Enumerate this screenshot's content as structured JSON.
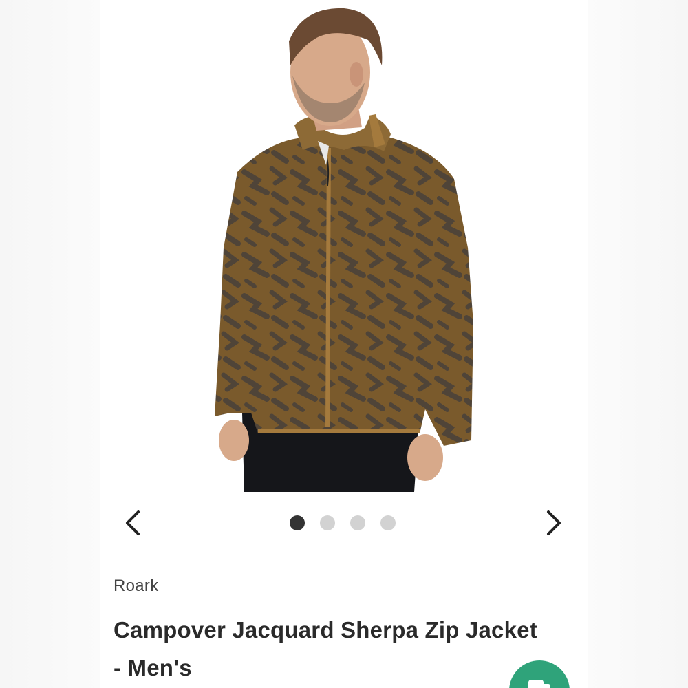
{
  "product": {
    "brand": "Roark",
    "title": "Campover Jacquard Sherpa Zip Jacket - Men's"
  },
  "carousel": {
    "total_images": 4,
    "active_index": 0,
    "prev_icon": "chevron-left-icon",
    "next_icon": "chevron-right-icon"
  },
  "chat": {
    "icon": "chat-icon",
    "color": "#2fa37a"
  },
  "colors": {
    "jacket": "#7a5a2c",
    "pattern": "#4f4438",
    "trim": "#a47a3d",
    "pants": "#15161a",
    "skin": "#d7a98a"
  }
}
